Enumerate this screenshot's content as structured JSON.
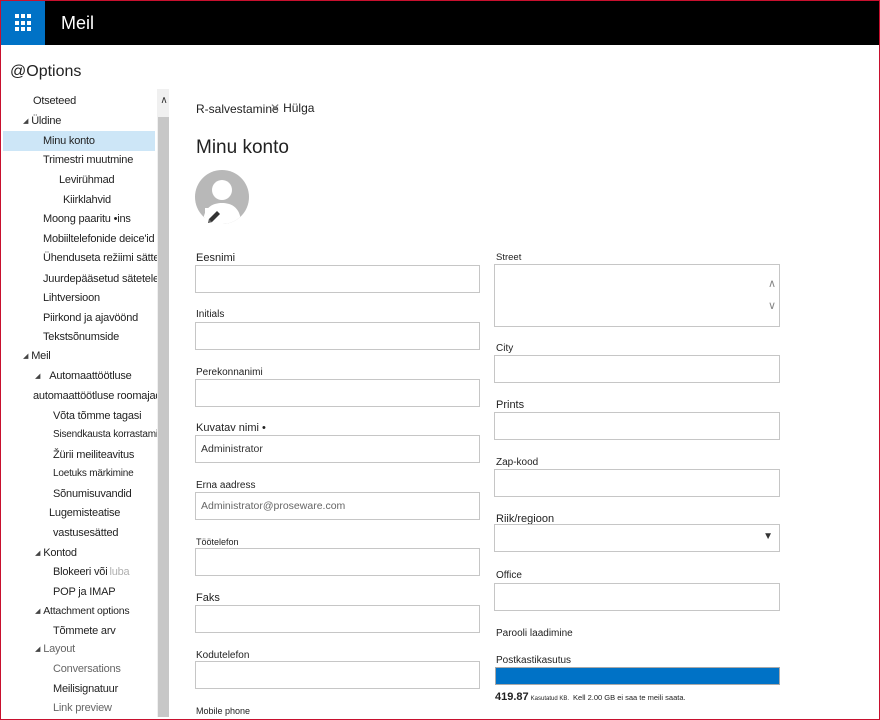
{
  "topbar": {
    "app_title": "Meil",
    "waffle_icon": "waffle-icon"
  },
  "options_title": "@Options",
  "nav": {
    "otseteed": "Otseteed",
    "uldine": "Üldine",
    "minu_konto": "Minu konto",
    "trimestri": "Trimestri muutmine",
    "levirühmad": "Levirühmad",
    "kiirklahvid": "Kiirklahvid",
    "moong": "Moong paaritu •ins",
    "mobiil": "Mobiiltelefonide deice'id",
    "uhenduseta": "Ühenduseta režiimi sätted",
    "juurdepaasetud": "Juurdepääsetud sätetele",
    "lihtversioon": "Lihtversioon",
    "piirkond": "Piirkond ja ajavöönd",
    "tekstsonumside": "Tekstsõnumside",
    "meil": "Meil",
    "automaattootluse": "Automaattöötluse",
    "automaattootluse_roomajad": "automaattöötluse roomajad",
    "vota_tomme": "Võta tõmme tagasi",
    "sisendkausta": "Sisendkausta korrastamisreeglid",
    "zurii": "Žürii meiliteavitus",
    "loetuks": "Loetuks märkimine",
    "sonumisuvandid": "Sõnumisuvandid",
    "lugemisteatise": "Lugemisteatise",
    "vastusesatted": "vastusesätted",
    "kontod": "Kontod",
    "blokeeri": "Blokeeri või",
    "blokeeri_ghost": "luba",
    "pop_imap": "POP ja IMAP",
    "attachment_options": "Attachment options",
    "tommete_arv": "Tõmmete arv",
    "layout": "Layout",
    "conversations": "Conversations",
    "meilisignatuur": "Meilisignatuur",
    "link_preview": "Link preview"
  },
  "toolbar": {
    "save_label": "R-salvestamine",
    "discard_label": "Hülga"
  },
  "page_title": "Minu konto",
  "form": {
    "eesnimi": {
      "label": "Eesnimi",
      "value": ""
    },
    "initials": {
      "label": "Initials",
      "value": ""
    },
    "perekonnanimi": {
      "label": "Perekonnanimi",
      "value": ""
    },
    "kuvatav_nimi": {
      "label": "Kuvatav nimi •",
      "value": "Administrator"
    },
    "erna_aadress": {
      "label": "Erna aadress",
      "value": "Administrator@proseware.com"
    },
    "tootelefon": {
      "label": "Töötelefon",
      "value": ""
    },
    "faks": {
      "label": "Faks",
      "value": ""
    },
    "kodutelefon": {
      "label": "Kodutelefon",
      "value": ""
    },
    "mobile_phone": {
      "label": "Mobile phone"
    },
    "street": {
      "label": "Street",
      "value": ""
    },
    "city": {
      "label": "City",
      "value": ""
    },
    "prints": {
      "label": "Prints",
      "value": ""
    },
    "zap_kood": {
      "label": "Zap-kood",
      "value": ""
    },
    "riik": {
      "label": "Riik/regioon",
      "value": ""
    },
    "office": {
      "label": "Office",
      "value": ""
    },
    "parooli": {
      "label": "Parooli laadimine"
    },
    "postkasti": {
      "label": "Postkastikasutus"
    }
  },
  "quota": {
    "amount": "419.87",
    "unit": "Kasutatud KB.",
    "description": "Kell 2.00 GB ei saa te meili saata.",
    "fill_fraction": 1.0,
    "color": "#0072c6"
  },
  "colors": {
    "accent": "#0072c6",
    "selected_nav": "#cde6f7",
    "topbar": "#000000",
    "frame": "#c8102e"
  }
}
